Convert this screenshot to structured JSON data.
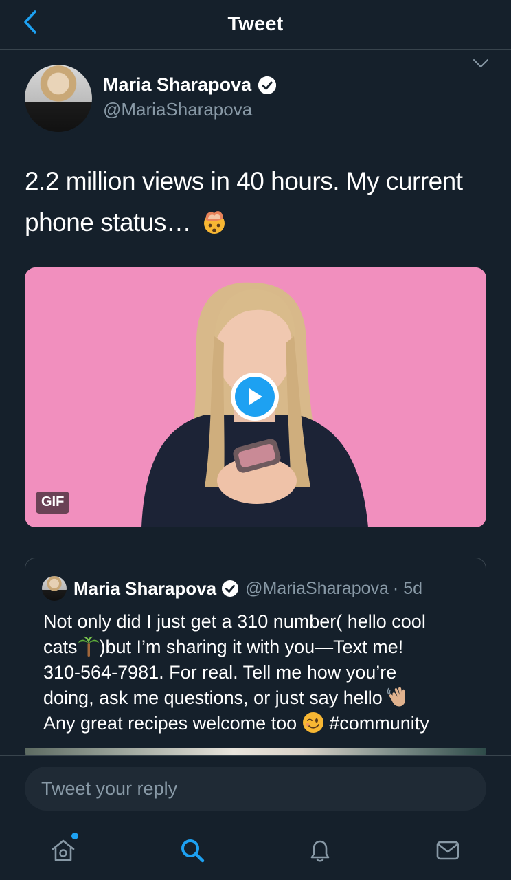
{
  "header": {
    "title": "Tweet"
  },
  "tweet": {
    "author_name": "Maria Sharapova",
    "author_handle": "@MariaSharapova",
    "text_line1": "2.2 million views in 40 hours. My current",
    "text_line2": "phone status…",
    "emoji": "exploding-head",
    "media": {
      "badge": "GIF",
      "type": "gif"
    }
  },
  "quote": {
    "author_name": "Maria Sharapova",
    "author_handle": "@MariaSharapova",
    "age": "· 5d",
    "line1": "Not only did I just get a 310 number( hello cool",
    "line2_a": "cats",
    "line2_b": ")but I’m sharing it with you—Text me!",
    "line3": "310-564-7981. For real. Tell me how you’re",
    "line4": "doing, ask me questions, or just say hello",
    "line5_a": "Any great recipes welcome too",
    "line5_b": "#community",
    "emojis": [
      "palm-tree",
      "waving-hand",
      "winking-face"
    ]
  },
  "compose": {
    "placeholder": "Tweet your reply"
  },
  "tabs": [
    {
      "name": "home",
      "icon": "home-icon",
      "notification_dot": true
    },
    {
      "name": "search",
      "icon": "search-icon",
      "active": true
    },
    {
      "name": "notifications",
      "icon": "bell-icon"
    },
    {
      "name": "messages",
      "icon": "mail-icon"
    }
  ],
  "colors": {
    "background": "#15202b",
    "accent": "#1da1f2",
    "secondary_text": "#8899a6",
    "divider": "#38444d"
  }
}
